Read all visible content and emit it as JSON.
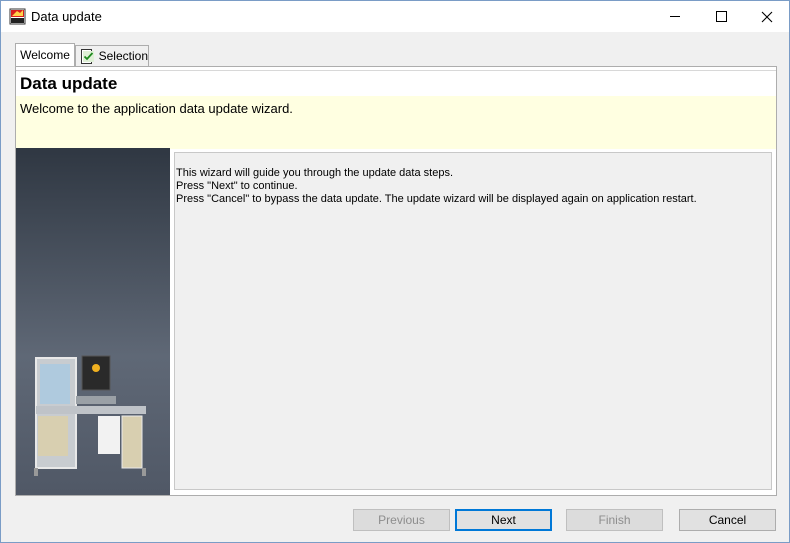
{
  "window": {
    "title": "Data update",
    "icon": "app-2017-icon"
  },
  "tabs": [
    {
      "label": "Welcome",
      "active": true
    },
    {
      "label": "Selection",
      "checked": true
    }
  ],
  "header": {
    "title": "Data update",
    "subtitle": "Welcome to the application data update wizard."
  },
  "content": {
    "lines": [
      "This wizard will guide you through the update data steps.",
      "Press \"Next\" to continue.",
      "Press \"Cancel\" to bypass the data update. The update wizard will be displayed again on application restart."
    ]
  },
  "buttons": {
    "previous": "Previous",
    "next": "Next",
    "finish": "Finish",
    "cancel": "Cancel"
  },
  "colors": {
    "header_bg": "#ffffe1",
    "default_button_border": "#0078d7"
  }
}
